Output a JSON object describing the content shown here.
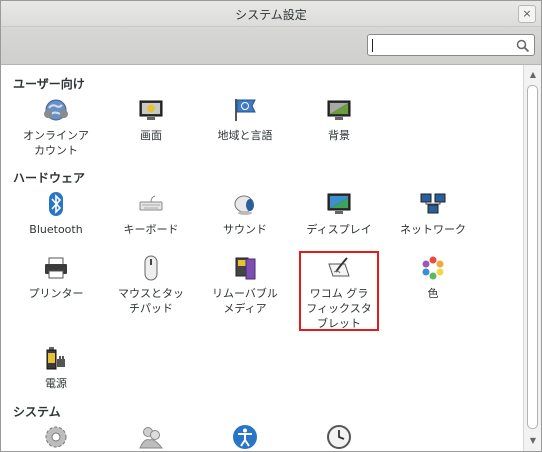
{
  "window": {
    "title": "システム設定",
    "close_glyph": "×"
  },
  "search": {
    "value": "",
    "placeholder": "",
    "icon": "search-icon"
  },
  "sections": {
    "personal": {
      "label": "ユーザー向け",
      "items": [
        {
          "label": "オンラインア\nカウント",
          "icon": "online-accounts-icon"
        },
        {
          "label": "画面",
          "icon": "display-icon"
        },
        {
          "label": "地域と言語",
          "icon": "region-language-icon"
        },
        {
          "label": "背景",
          "icon": "background-icon"
        }
      ]
    },
    "hardware": {
      "label": "ハードウェア",
      "items": [
        {
          "label": "Bluetooth",
          "icon": "bluetooth-icon"
        },
        {
          "label": "キーボード",
          "icon": "keyboard-icon"
        },
        {
          "label": "サウンド",
          "icon": "sound-icon"
        },
        {
          "label": "ディスプレイ",
          "icon": "monitor-icon"
        },
        {
          "label": "ネットワーク",
          "icon": "network-icon"
        },
        {
          "label": "プリンター",
          "icon": "printer-icon"
        },
        {
          "label": "マウスとタッ\nチパッド",
          "icon": "mouse-icon"
        },
        {
          "label": "リムーバブル\nメディア",
          "icon": "removable-media-icon"
        },
        {
          "label": "ワコム グラ\nフィックスタ\nブレット",
          "icon": "wacom-tablet-icon",
          "highlighted": true
        },
        {
          "label": "色",
          "icon": "color-icon"
        },
        {
          "label": "電源",
          "icon": "power-icon"
        }
      ]
    },
    "system": {
      "label": "システム",
      "items": [
        {
          "label": "",
          "icon": "details-gear-icon"
        },
        {
          "label": "",
          "icon": "users-icon"
        },
        {
          "label": "",
          "icon": "universal-access-icon"
        },
        {
          "label": "",
          "icon": "date-time-icon"
        }
      ]
    }
  },
  "colors": {
    "highlight_border": "#e41b1b",
    "accent_blue": "#2a76c6"
  }
}
